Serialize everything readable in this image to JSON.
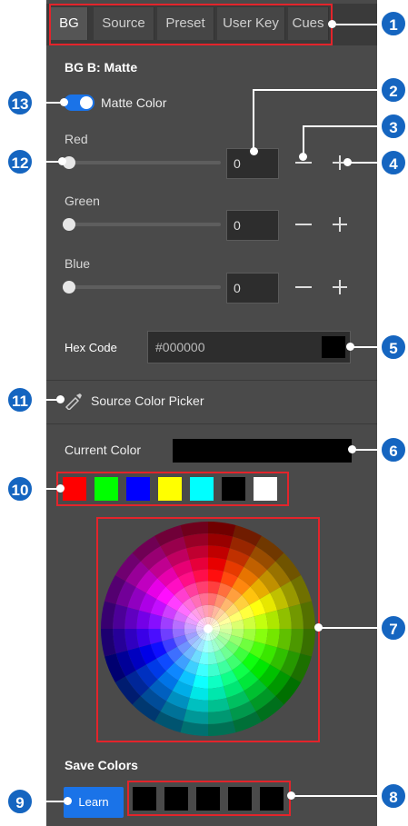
{
  "tabs": [
    {
      "label": "BG",
      "active": true
    },
    {
      "label": "Source",
      "active": false
    },
    {
      "label": "Preset",
      "active": false
    },
    {
      "label": "User Key",
      "active": false
    },
    {
      "label": "Cues",
      "active": false
    }
  ],
  "section_title": "BG B: Matte",
  "matte_toggle": {
    "label": "Matte Color",
    "on": true
  },
  "channels": [
    {
      "label": "Red",
      "value": "0"
    },
    {
      "label": "Green",
      "value": "0"
    },
    {
      "label": "Blue",
      "value": "0"
    }
  ],
  "hex": {
    "label": "Hex Code",
    "value": "#000000"
  },
  "picker": {
    "label": "Source Color Picker"
  },
  "current_color": {
    "label": "Current Color",
    "color": "#000000"
  },
  "preset_colors": [
    "#ff0000",
    "#00ff00",
    "#0000ff",
    "#ffff00",
    "#00ffff",
    "#000000",
    "#ffffff"
  ],
  "save_colors": {
    "title": "Save Colors",
    "learn_label": "Learn",
    "slots": [
      "#000000",
      "#000000",
      "#000000",
      "#000000",
      "#000000"
    ]
  },
  "callouts": [
    "1",
    "2",
    "3",
    "4",
    "5",
    "6",
    "7",
    "8",
    "9",
    "10",
    "11",
    "12",
    "13"
  ],
  "colors": {
    "accent": "#1565c0",
    "highlight": "#e3242b",
    "panel": "#4a4a4a"
  }
}
